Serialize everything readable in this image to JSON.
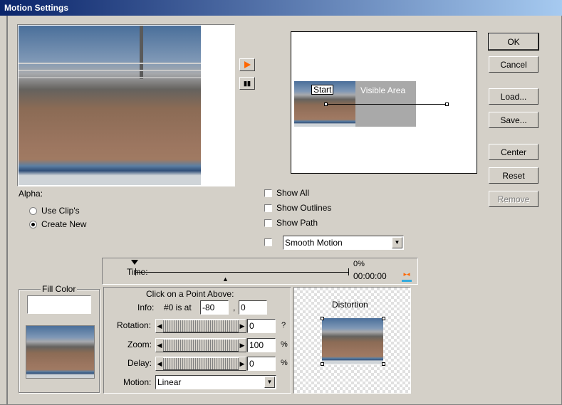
{
  "window": {
    "title": "Motion Settings"
  },
  "buttons": {
    "ok": "OK",
    "cancel": "Cancel",
    "load": "Load...",
    "save": "Save...",
    "center": "Center",
    "reset": "Reset",
    "remove": "Remove"
  },
  "alpha": {
    "label": "Alpha:",
    "use_clips": "Use Clip's",
    "create_new": "Create New",
    "selected": "create_new"
  },
  "visible_area": {
    "start_label": "Start",
    "area_label": "Visible Area"
  },
  "options": {
    "show_all": {
      "label": "Show All",
      "checked": false
    },
    "show_outlines": {
      "label": "Show Outlines",
      "checked": false
    },
    "show_path": {
      "label": "Show Path",
      "checked": false
    },
    "smooth_motion": {
      "checked": false,
      "value": "Smooth Motion"
    }
  },
  "time": {
    "label": "Time:",
    "percent": "0%",
    "timecode": "00:00:00"
  },
  "fill_color": {
    "label": "Fill Color",
    "value": "#ffffff"
  },
  "point": {
    "heading": "Click on a Point Above:",
    "info_label": "Info:",
    "info_text": "#0 is at",
    "x_value": "-80",
    "separator": ",",
    "y_value": "0"
  },
  "rotation": {
    "label": "Rotation:",
    "value": "0",
    "unit": "?"
  },
  "zoom": {
    "label": "Zoom:",
    "value": "100",
    "unit": "%"
  },
  "delay": {
    "label": "Delay:",
    "value": "0",
    "unit": "%"
  },
  "motion": {
    "label": "Motion:",
    "value": "Linear"
  },
  "distortion": {
    "label": "Distortion"
  },
  "colors": {
    "accent_play": "#ff6600",
    "titlebar": "#0a246a"
  }
}
